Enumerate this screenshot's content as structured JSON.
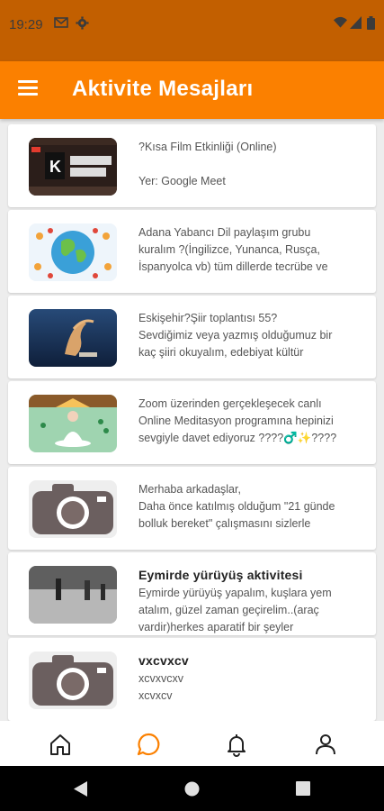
{
  "status": {
    "time": "19:29",
    "icons": [
      "gmail-icon",
      "settings-icon",
      "wifi-icon",
      "signal-icon",
      "battery-icon"
    ]
  },
  "appbar": {
    "title": "Aktivite Mesajları",
    "menu_icon": "hamburger-menu-icon"
  },
  "colors": {
    "primary": "#fb8000",
    "status_bar": "#c25f00",
    "nav_active": "#fb8000"
  },
  "messages": [
    {
      "title": "",
      "lines": [
        "?Kısa Film Etkinliği (Online)",
        "",
        "Yer: Google Meet"
      ],
      "thumb": "film-event"
    },
    {
      "title": "",
      "lines": [
        "Adana Yabancı Dil paylaşım grubu",
        "kuralım ?(İngilizce, Yunanca, Rusça,",
        "İspanyolca vb) tüm dillerde tecrübe ve"
      ],
      "thumb": "globe"
    },
    {
      "title": "",
      "lines": [
        "Eskişehir?Şiir toplantısı 55?",
        "Sevdiğimiz veya yazmış olduğumuz bir",
        "kaç şiiri okuyalım, edebiyat kültür"
      ],
      "thumb": "book-art"
    },
    {
      "title": "",
      "lines": [
        "Zoom üzerinden gerçekleşecek canlı",
        "Online Meditasyon programına hepinizi",
        "sevgiyle davet ediyoruz ????♂️✨????"
      ],
      "thumb": "meditation"
    },
    {
      "title": "",
      "lines": [
        "Merhaba arkadaşlar,",
        "Daha önce katılmış olduğum \"21 günde",
        "bolluk bereket\" çalışmasını sizlerle"
      ],
      "thumb": "camera-mosaic"
    },
    {
      "title": "Eymirde yürüyüş aktivitesi",
      "lines": [
        "Eymirde yürüyüş yapalım, kuşlara yem",
        "atalım, güzel zaman geçirelim..(araç",
        "vardir)herkes aparatif bir şeyler"
      ],
      "thumb": "walking"
    },
    {
      "title": "vxcvxcv",
      "lines": [
        "xcvxvcxv",
        "xcvxcv"
      ],
      "thumb": "camera-mosaic"
    }
  ],
  "bottom_nav": [
    "home-icon",
    "chat-icon",
    "bell-icon",
    "profile-icon"
  ],
  "system_nav": [
    "back-icon",
    "home-circle-icon",
    "recents-icon"
  ]
}
